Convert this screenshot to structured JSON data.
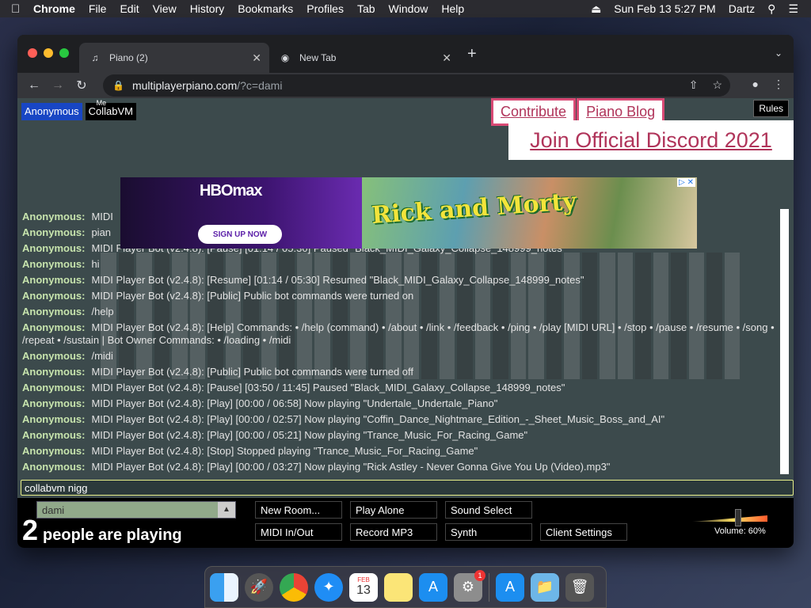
{
  "menubar": {
    "app": "Chrome",
    "items": [
      "File",
      "Edit",
      "View",
      "History",
      "Bookmarks",
      "Profiles",
      "Tab",
      "Window",
      "Help"
    ],
    "datetime": "Sun Feb 13  5:27 PM",
    "user": "Dartz"
  },
  "browser": {
    "tabs": [
      {
        "label": "Piano (2)",
        "active": true
      },
      {
        "label": "New Tab",
        "active": false
      }
    ],
    "url_host": "multiplayerpiano.com",
    "url_path": "/?c=dami"
  },
  "page": {
    "participants": [
      {
        "name": "Anonymous",
        "me": true
      },
      {
        "name": "CollabVM",
        "me": false
      }
    ],
    "me_label": "Me",
    "links": [
      "Contribute",
      "Piano Blog"
    ],
    "rules_label": "Rules",
    "discord_label": "Join Official Discord 2021",
    "ad": {
      "logo": "HBOmax",
      "cta": "SIGN UP NOW",
      "title": "Rick and Morty",
      "close": "▷ ✕"
    },
    "chat": [
      {
        "name": "Anonymous:",
        "msg": "MIDI"
      },
      {
        "name": "Anonymous:",
        "msg": "pian"
      },
      {
        "name": "Anonymous:",
        "msg": "MIDI Player Bot (v2.4.8): [Pause] [01:14 / 05:30] Paused \"Black_MIDI_Galaxy_Collapse_148999_notes\""
      },
      {
        "name": "Anonymous:",
        "msg": "hi"
      },
      {
        "name": "Anonymous:",
        "msg": "MIDI Player Bot (v2.4.8): [Resume] [01:14 / 05:30] Resumed \"Black_MIDI_Galaxy_Collapse_148999_notes\""
      },
      {
        "name": "Anonymous:",
        "msg": "MIDI Player Bot (v2.4.8): [Public] Public bot commands were turned on"
      },
      {
        "name": "Anonymous:",
        "msg": "/help"
      },
      {
        "name": "Anonymous:",
        "msg": "MIDI Player Bot (v2.4.8): [Help] Commands: • /help (command) • /about • /link • /feedback • /ping • /play [MIDI URL] • /stop • /pause • /resume • /song • /repeat • /sustain | Bot Owner Commands: • /loading • /midi",
        "wrap": true
      },
      {
        "name": "Anonymous:",
        "msg": "/midi"
      },
      {
        "name": "Anonymous:",
        "msg": "MIDI Player Bot (v2.4.8): [Public] Public bot commands were turned off"
      },
      {
        "name": "Anonymous:",
        "msg": "MIDI Player Bot (v2.4.8): [Pause] [03:50 / 11:45] Paused \"Black_MIDI_Galaxy_Collapse_148999_notes\""
      },
      {
        "name": "Anonymous:",
        "msg": "MIDI Player Bot (v2.4.8): [Play] [00:00 / 06:58] Now playing \"Undertale_Undertale_Piano\""
      },
      {
        "name": "Anonymous:",
        "msg": "MIDI Player Bot (v2.4.8): [Play] [00:00 / 02:57] Now playing \"Coffin_Dance_Nightmare_Edition_-_Sheet_Music_Boss_and_AI\""
      },
      {
        "name": "Anonymous:",
        "msg": "MIDI Player Bot (v2.4.8): [Play] [00:00 / 05:21] Now playing \"Trance_Music_For_Racing_Game\""
      },
      {
        "name": "Anonymous:",
        "msg": "MIDI Player Bot (v2.4.8): [Stop] Stopped playing \"Trance_Music_For_Racing_Game\""
      },
      {
        "name": "Anonymous:",
        "msg": "MIDI Player Bot (v2.4.8): [Play] [00:00 / 03:27] Now playing \"Rick Astley - Never Gonna Give You Up (Video).mp3\""
      }
    ],
    "chat_input": "collabvm nigg",
    "room": "dami",
    "player_count": "2",
    "playing_text": "people are playing",
    "buttons": {
      "new_room": "New Room...",
      "play_alone": "Play Alone",
      "sound_select": "Sound Select",
      "midi_io": "MIDI In/Out",
      "record_mp3": "Record MP3",
      "synth": "Synth",
      "client_settings": "Client Settings"
    },
    "volume_label": "Volume: 60%",
    "volume_level": 0.6
  },
  "dock": {
    "calendar_month": "FEB",
    "calendar_day": "13",
    "settings_badge": "1"
  },
  "colors": {
    "page_bg": "#3c4a4c",
    "chat_name": "#c7e4ad",
    "me_badge": "#1846c4",
    "link_pink": "#b0345a"
  }
}
